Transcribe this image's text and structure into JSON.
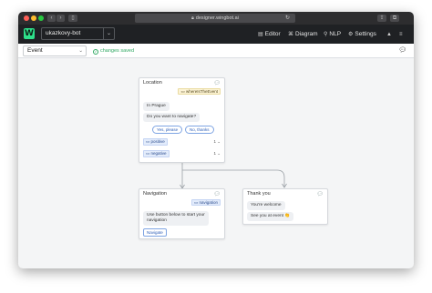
{
  "browser": {
    "url": "designer.wingbot.ai",
    "nav_back": "‹",
    "nav_forward": "›",
    "sidebar_icon": "sidebar-icon",
    "reload_icon": "↻",
    "share_icon": "⇪",
    "tabs_icon": "⧉"
  },
  "app": {
    "logo_letter": "W",
    "bot_name": "ukazkovy-bot",
    "menu": [
      {
        "icon": "editor-icon",
        "glyph": "▤",
        "label": "Editor"
      },
      {
        "icon": "diagram-icon",
        "glyph": "⌘",
        "label": "Diagram"
      },
      {
        "icon": "nlp-icon",
        "glyph": "⚲",
        "label": "NLP"
      },
      {
        "icon": "settings-icon",
        "glyph": "⚙",
        "label": "Settings"
      },
      {
        "icon": "user-icon",
        "glyph": "▲",
        "label": ""
      },
      {
        "icon": "menu-icon",
        "glyph": "≡",
        "label": ""
      }
    ]
  },
  "toolbar": {
    "event_select": "Event",
    "saved_status": "changes saved",
    "chat_icon": "chat-icon"
  },
  "cards": {
    "location": {
      "title": "Location",
      "trigger": "whereIsTheEvent",
      "message1": "In Prague",
      "message2": "Do you want to navigate?",
      "quick_replies": [
        "Yes, please",
        "No, thanks"
      ],
      "intents": [
        {
          "label": "positive",
          "count": "1"
        },
        {
          "label": "negative",
          "count": "1"
        }
      ]
    },
    "navigation": {
      "title": "Navigation",
      "trigger": "navigation",
      "message_line1": "Use button below to start your",
      "message_line2": "navigation",
      "button": "Navigate"
    },
    "thankyou": {
      "title": "Thank you",
      "message1": "You're welcome",
      "message2": "See you at event 👏"
    }
  },
  "colors": {
    "accent_green": "#2ee08a",
    "link_blue": "#2e5fb8",
    "saved_green": "#2fa862"
  }
}
